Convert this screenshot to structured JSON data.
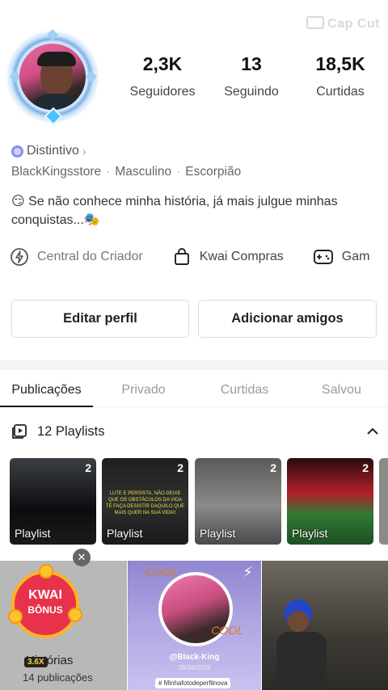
{
  "watermark": "Cap Cut",
  "profile": {
    "stats": [
      {
        "value": "2,3K",
        "label": "Seguidores"
      },
      {
        "value": "13",
        "label": "Seguindo"
      },
      {
        "value": "18,5K",
        "label": "Curtidas"
      }
    ],
    "badge_label": "Distintivo",
    "username": "BlackKingsstore",
    "gender": "Masculino",
    "sign": "Escorpião",
    "bio": "😏 Se não conhece minha história, já mais julgue minhas conquistas...🎭"
  },
  "shortcuts": [
    {
      "label": "Central do Criador",
      "icon": "lightning-icon"
    },
    {
      "label": "Kwai Compras",
      "icon": "shopping-bag-icon"
    },
    {
      "label": "Gam",
      "icon": "gamepad-icon"
    }
  ],
  "buttons": {
    "edit": "Editar perfil",
    "add": "Adicionar amigos"
  },
  "tabs": [
    "Publicações",
    "Privado",
    "Curtidas",
    "Salvou"
  ],
  "playlists": {
    "title": "12 Playlists",
    "items": [
      {
        "label": "Playlist",
        "count": "2",
        "caption": ""
      },
      {
        "label": "Playlist",
        "count": "2",
        "caption": "LUTE E PERSISTA, NÃO DEIXE QUE OS OBSTÁCULOS DA VIDA TE FAÇA DESISTIR DAQUILO QUE MAIS QUER NA SUA VIDA!!"
      },
      {
        "label": "Playlist",
        "count": "2",
        "caption": ""
      },
      {
        "label": "Playlist",
        "count": "2",
        "caption": ""
      }
    ]
  },
  "grid": {
    "ad": {
      "bonus_line1": "KWAI",
      "bonus_line2": "BÔNUS",
      "speed": "3.6X",
      "title": "Histórias",
      "subtitle": "14 publicações"
    },
    "post": {
      "handle": "@Black-King",
      "date": "28/04/2024",
      "tag": "# Minhafotodeperfilnova",
      "cool": "COOL"
    }
  },
  "colors": {
    "accent": "#111111",
    "badge": "#8b8cf0",
    "ad_red": "#e8324b"
  }
}
